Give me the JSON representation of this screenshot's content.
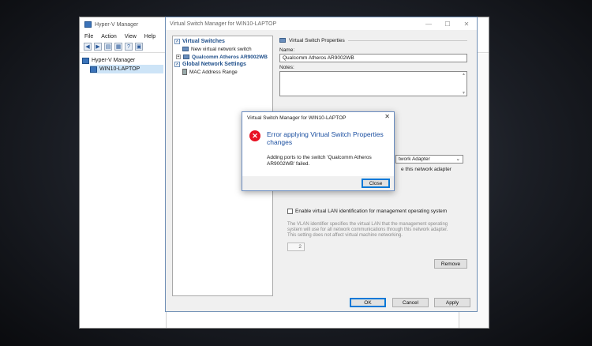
{
  "hyperv": {
    "title": "Hyper-V Manager",
    "menu": [
      "File",
      "Action",
      "View",
      "Help"
    ],
    "tree": {
      "root": "Hyper-V Manager",
      "host": "WIN10-LAPTOP"
    }
  },
  "vsm": {
    "title": "Virtual Switch Manager for WIN10-LAPTOP",
    "sections": {
      "virtual_switches": "Virtual Switches",
      "new_switch": "New virtual network switch",
      "switch_name": "Qualcomm Atheros AR9002WB",
      "global": "Global Network Settings",
      "mac": "MAC Address Range"
    },
    "props": {
      "header": "Virtual Switch Properties",
      "name_label": "Name:",
      "name_value": "Qualcomm Atheros AR9002WB",
      "notes_label": "Notes:",
      "adapter_value": "twork Adapter",
      "share_text": "e this network adapter",
      "vlan_check": "Enable virtual LAN identification for management operating system",
      "vlan_desc": "The VLAN identifier specifies the virtual LAN that the management operating system will use for all network communications through this network adapter. This setting does not affect virtual machine networking.",
      "vlan_id": "2",
      "remove": "Remove"
    },
    "buttons": {
      "ok": "OK",
      "cancel": "Cancel",
      "apply": "Apply"
    }
  },
  "dialog": {
    "title": "Virtual Switch Manager for WIN10-LAPTOP",
    "heading": "Error applying Virtual Switch Properties changes",
    "message": "Adding ports to the switch 'Qualcomm Atheros AR9002WB' failed.",
    "close": "Close"
  },
  "colors": {
    "accent": "#0078d7",
    "error": "#e81123",
    "link_blue": "#1f4f8a"
  }
}
